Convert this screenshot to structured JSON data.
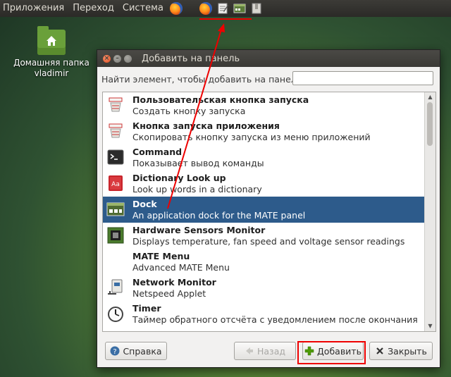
{
  "top_panel": {
    "menu": [
      "Приложения",
      "Переход",
      "Система"
    ],
    "icons": [
      "firefox-icon",
      "text-editor-icon",
      "dock-icon",
      "archive-icon"
    ]
  },
  "desktop": {
    "home_folder": {
      "line1": "Домашняя папка",
      "line2": "vladimir"
    }
  },
  "dialog": {
    "title": "Добавить на панель",
    "search": {
      "label": "Найти элемент, чтобы добавить на панель:",
      "value": "",
      "placeholder": ""
    },
    "items": [
      {
        "title": "Пользовательская кнопка запуска",
        "desc": "Создать кнопку запуска",
        "icon": "custom-launcher-icon"
      },
      {
        "title": "Кнопка запуска приложения",
        "desc": "Скопировать кнопку запуска из меню приложений",
        "icon": "app-launcher-icon"
      },
      {
        "title": "Command",
        "desc": "Показывает вывод команды",
        "icon": "terminal-icon"
      },
      {
        "title": "Dictionary Look up",
        "desc": "Look up words in a dictionary",
        "icon": "dictionary-icon"
      },
      {
        "title": "Dock",
        "desc": "An application dock for the MATE panel",
        "icon": "dock-icon",
        "selected": true
      },
      {
        "title": "Hardware Sensors Monitor",
        "desc": "Displays temperature, fan speed and voltage sensor readings",
        "icon": "sensors-icon"
      },
      {
        "title": "MATE Menu",
        "desc": "Advanced MATE Menu",
        "icon": "mate-menu-icon"
      },
      {
        "title": "Network Monitor",
        "desc": "Netspeed Applet",
        "icon": "network-icon"
      },
      {
        "title": "Timer",
        "desc": "Таймер обратного отсчёта с уведомлением после окончания",
        "icon": "timer-icon"
      }
    ],
    "buttons": {
      "help": "Справка",
      "back": "Назад",
      "add": "Добавить",
      "close": "Закрыть"
    }
  },
  "colors": {
    "selection": "#2d5b8b",
    "annotation": "#e00000",
    "panel": "#3c3b37"
  }
}
